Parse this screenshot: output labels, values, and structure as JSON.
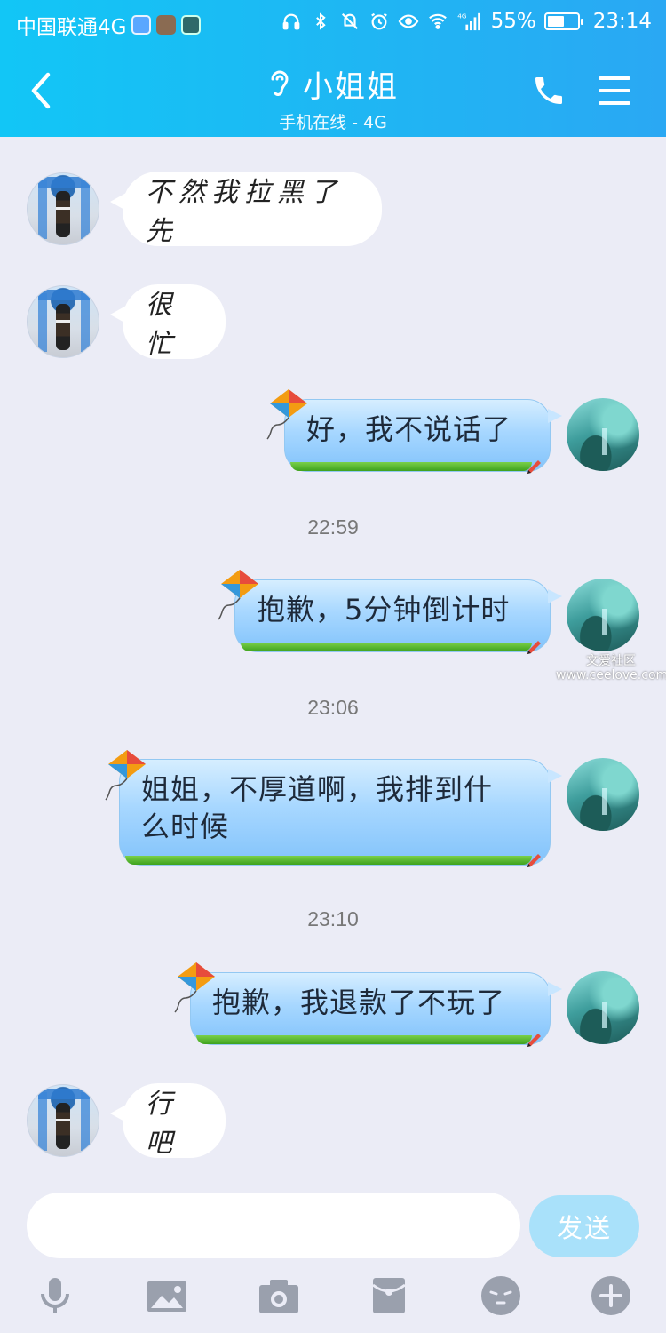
{
  "status_bar": {
    "carrier": "中国联通4G",
    "network_type": "4G",
    "battery": "55%",
    "battery_level": 0.55,
    "time": "23:14"
  },
  "header": {
    "title": "小姐姐",
    "subtitle": "手机在线 - 4G"
  },
  "messages": [
    {
      "side": "left",
      "text": "不然我拉黑了先"
    },
    {
      "side": "left",
      "text": "很忙"
    },
    {
      "side": "right",
      "text": "好，我不说话了"
    },
    {
      "side": "time",
      "text": "22:59"
    },
    {
      "side": "right",
      "text": "抱歉，5分钟倒计时"
    },
    {
      "side": "time",
      "text": "23:06"
    },
    {
      "side": "right",
      "text_line1": "姐姐，不厚道啊，我排到什",
      "text_line2": "么时候"
    },
    {
      "side": "time",
      "text": "23:10"
    },
    {
      "side": "right",
      "text": "抱歉，我退款了不玩了"
    },
    {
      "side": "left",
      "text": "行吧"
    }
  ],
  "watermark": {
    "line1": "文爱社区",
    "line2": "www.ceelove.com"
  },
  "input": {
    "send_label": "发送"
  },
  "toolbar": [
    "microphone-icon",
    "image-icon",
    "camera-icon",
    "red-packet-icon",
    "emoji-icon",
    "plus-icon"
  ],
  "colors": {
    "header": "#1fb6f3",
    "background": "#ebecf6",
    "send_button": "#a9e1fa"
  }
}
